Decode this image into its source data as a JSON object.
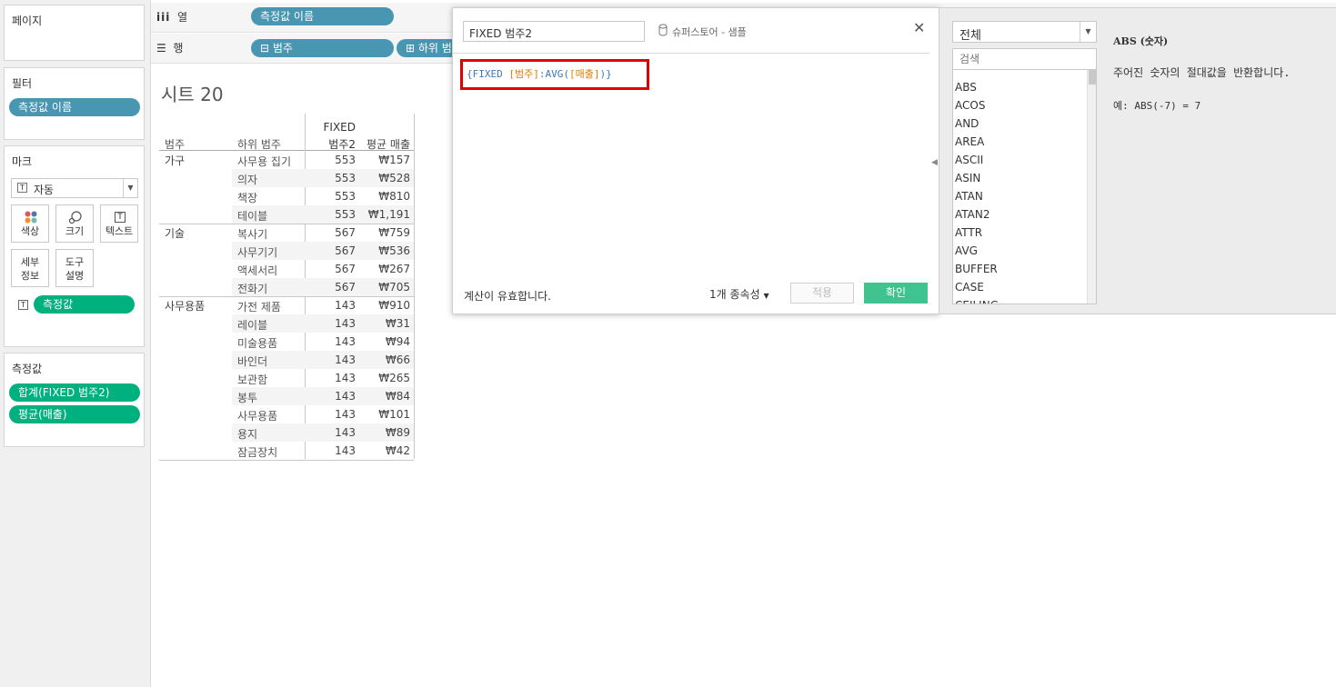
{
  "left": {
    "pages_title": "페이지",
    "filters_title": "필터",
    "filter_pill": "측정값 이름",
    "marks_title": "마크",
    "mark_type": "자동",
    "mark_buttons": {
      "color": "색상",
      "size": "크기",
      "text": "텍스트",
      "detail": "세부\n정보",
      "tooltip": "도구\n설명"
    },
    "mark_pill": "측정값",
    "measures_title": "측정값",
    "measure_pills": [
      "합계(FIXED 범주2)",
      "평균(매출)"
    ]
  },
  "shelves": {
    "columns_label": "열",
    "columns_pill": "측정값 이름",
    "rows_label": "행",
    "rows_pills": [
      "범주",
      "하위 범"
    ]
  },
  "sheet": {
    "title": "시트 20",
    "headers": {
      "category": "범주",
      "subcategory": "하위 범주",
      "fixed_line1": "FIXED",
      "fixed_line2": "범주2",
      "avg": "평균 매출"
    },
    "groups": [
      {
        "category": "가구",
        "rows": [
          {
            "sub": "사무용 집기",
            "fixed": "553",
            "avg": "₩157"
          },
          {
            "sub": "의자",
            "fixed": "553",
            "avg": "₩528"
          },
          {
            "sub": "책장",
            "fixed": "553",
            "avg": "₩810"
          },
          {
            "sub": "테이블",
            "fixed": "553",
            "avg": "₩1,191"
          }
        ]
      },
      {
        "category": "기술",
        "rows": [
          {
            "sub": "복사기",
            "fixed": "567",
            "avg": "₩759"
          },
          {
            "sub": "사무기기",
            "fixed": "567",
            "avg": "₩536"
          },
          {
            "sub": "액세서리",
            "fixed": "567",
            "avg": "₩267"
          },
          {
            "sub": "전화기",
            "fixed": "567",
            "avg": "₩705"
          }
        ]
      },
      {
        "category": "사무용품",
        "rows": [
          {
            "sub": "가전 제품",
            "fixed": "143",
            "avg": "₩910"
          },
          {
            "sub": "레이블",
            "fixed": "143",
            "avg": "₩31"
          },
          {
            "sub": "미술용품",
            "fixed": "143",
            "avg": "₩94"
          },
          {
            "sub": "바인더",
            "fixed": "143",
            "avg": "₩66"
          },
          {
            "sub": "보관함",
            "fixed": "143",
            "avg": "₩265"
          },
          {
            "sub": "봉투",
            "fixed": "143",
            "avg": "₩84"
          },
          {
            "sub": "사무용품",
            "fixed": "143",
            "avg": "₩101"
          },
          {
            "sub": "용지",
            "fixed": "143",
            "avg": "₩89"
          },
          {
            "sub": "잠금장치",
            "fixed": "143",
            "avg": "₩42"
          }
        ]
      }
    ]
  },
  "dialog": {
    "name": "FIXED 범주2",
    "datasource": "슈퍼스토어 - 샘플",
    "formula": {
      "open": "{FIXED ",
      "field1": "[범주]",
      "mid": ":AVG(",
      "field2": "[매출]",
      "close": ")}"
    },
    "status": "계산이 유효합니다.",
    "dependencies": "1개 종속성",
    "apply": "적용",
    "ok": "확인"
  },
  "functions": {
    "category": "전체",
    "search_placeholder": "검색",
    "items": [
      "ABS",
      "ACOS",
      "AND",
      "AREA",
      "ASCII",
      "ASIN",
      "ATAN",
      "ATAN2",
      "ATTR",
      "AVG",
      "BUFFER",
      "CASE",
      "CEILING"
    ],
    "help_title": "ABS (숫자)",
    "help_desc": "주어진 숫자의 절대값을 반환합니다.",
    "help_example": "예: ABS(-7) = 7"
  },
  "colors": {
    "pill_blue": "#4996b2",
    "pill_green": "#00b180",
    "ok_button": "#3fc48f",
    "highlight_box": "#e00000"
  }
}
